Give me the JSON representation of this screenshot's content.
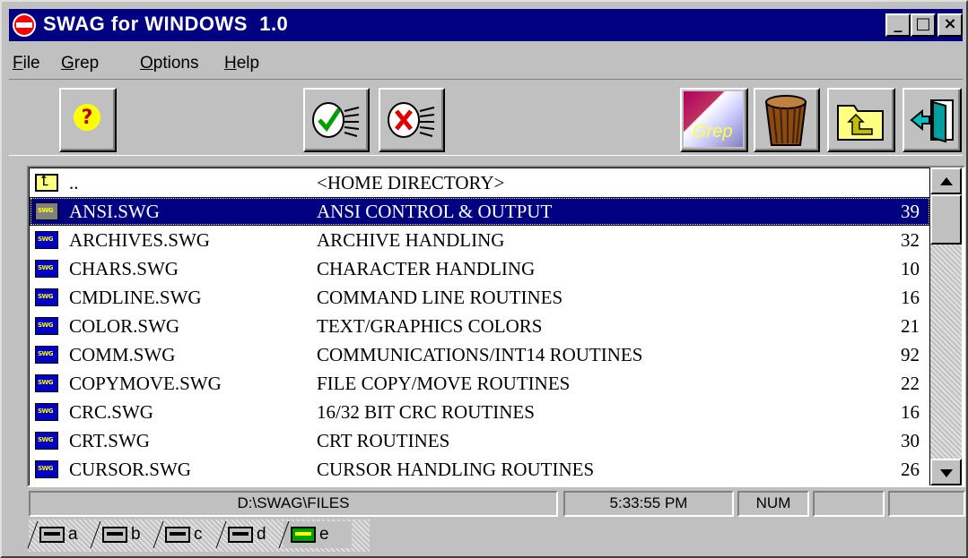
{
  "window": {
    "title": "SWAG for WINDOWS  1.0"
  },
  "titlebar_buttons": {
    "minimize": "_",
    "maximize": "□",
    "close": "×"
  },
  "menu": [
    {
      "label": "File"
    },
    {
      "label": "Grep"
    },
    {
      "label": "Options"
    },
    {
      "label": "Help"
    }
  ],
  "toolbar": {
    "help_icon": "question-icon",
    "accept_icon": "checkmark-letter-icon",
    "reject_icon": "x-letter-icon",
    "grep_label": "Grep",
    "trash_icon": "wastebasket-icon",
    "folder_icon": "open-folder-icon",
    "exit_icon": "exit-door-icon"
  },
  "list": {
    "rows": [
      {
        "name": "..",
        "description": "<HOME DIRECTORY>",
        "count": "",
        "icon": "up-directory-icon"
      },
      {
        "name": "ANSI.SWG",
        "description": "ANSI CONTROL & OUTPUT",
        "count": "39",
        "icon": "swg-file-icon",
        "selected": true
      },
      {
        "name": "ARCHIVES.SWG",
        "description": "ARCHIVE HANDLING",
        "count": "32",
        "icon": "swg-file-icon"
      },
      {
        "name": "CHARS.SWG",
        "description": "CHARACTER HANDLING",
        "count": "10",
        "icon": "swg-file-icon"
      },
      {
        "name": "CMDLINE.SWG",
        "description": "COMMAND LINE ROUTINES",
        "count": "16",
        "icon": "swg-file-icon"
      },
      {
        "name": "COLOR.SWG",
        "description": "TEXT/GRAPHICS COLORS",
        "count": "21",
        "icon": "swg-file-icon"
      },
      {
        "name": "COMM.SWG",
        "description": "COMMUNICATIONS/INT14 ROUTINES",
        "count": "92",
        "icon": "swg-file-icon"
      },
      {
        "name": "COPYMOVE.SWG",
        "description": "FILE COPY/MOVE ROUTINES",
        "count": "22",
        "icon": "swg-file-icon"
      },
      {
        "name": "CRC.SWG",
        "description": "16/32 BIT CRC ROUTINES",
        "count": "16",
        "icon": "swg-file-icon"
      },
      {
        "name": "CRT.SWG",
        "description": "CRT ROUTINES",
        "count": "30",
        "icon": "swg-file-icon"
      },
      {
        "name": "CURSOR.SWG",
        "description": "CURSOR HANDLING ROUTINES",
        "count": "26",
        "icon": "swg-file-icon"
      }
    ]
  },
  "statusbar": {
    "path": "D:\\SWAG\\FILES",
    "time": "5:33:55 PM",
    "num": "NUM",
    "panel4": "",
    "panel5": ""
  },
  "drive_tabs": [
    {
      "label": "a"
    },
    {
      "label": "b"
    },
    {
      "label": "c"
    },
    {
      "label": "d"
    },
    {
      "label": "e",
      "active": true
    }
  ],
  "colors": {
    "titlebar": "#000080",
    "selection": "#000080",
    "face": "#c0c0c0"
  }
}
